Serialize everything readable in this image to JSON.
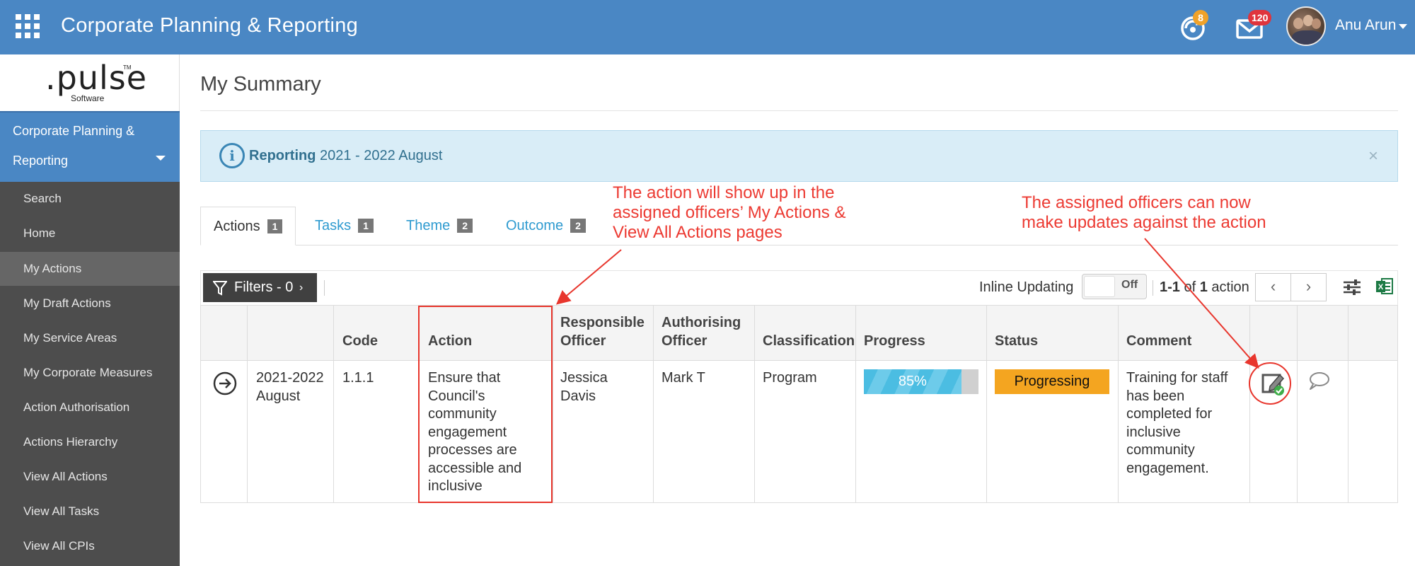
{
  "header": {
    "app_title": "Corporate Planning & Reporting",
    "notifications_count": "8",
    "messages_count": "120",
    "user_name": "Anu Arun"
  },
  "logo": {
    "name": ".pulse",
    "sub": "Software",
    "tm": "TM"
  },
  "sidebar": {
    "module_line1": "Corporate Planning &",
    "module_line2": "Reporting",
    "items": [
      {
        "label": "Search"
      },
      {
        "label": "Home"
      },
      {
        "label": "My Actions"
      },
      {
        "label": "My Draft Actions"
      },
      {
        "label": "My Service Areas"
      },
      {
        "label": "My Corporate Measures"
      },
      {
        "label": "Action Authorisation"
      },
      {
        "label": "Actions Hierarchy"
      },
      {
        "label": "View All Actions"
      },
      {
        "label": "View All Tasks"
      },
      {
        "label": "View All CPIs"
      }
    ]
  },
  "main": {
    "page_title": "My Summary",
    "banner": {
      "bold": "Reporting",
      "text": " 2021 - 2022 August",
      "close": "×"
    },
    "tabs": [
      {
        "label": "Actions",
        "count": "1"
      },
      {
        "label": "Tasks",
        "count": "1"
      },
      {
        "label": "Theme",
        "count": "2"
      },
      {
        "label": "Outcome",
        "count": "2"
      }
    ],
    "toolbar": {
      "filters_label": "Filters - 0",
      "filters_chevron": "›",
      "inline_updating_label": "Inline Updating",
      "toggle_state": "Off",
      "pager_range": "1-1",
      "pager_of": " of ",
      "pager_total": "1",
      "pager_unit": " action",
      "prev": "‹",
      "next": "›"
    },
    "table": {
      "headers": {
        "code": "Code",
        "action": "Action",
        "responsible_1": "Responsible",
        "responsible_2": "Officer",
        "authorising_1": "Authorising",
        "authorising_2": "Officer",
        "classification": "Classification",
        "progress": "Progress",
        "status": "Status",
        "comment": "Comment"
      },
      "row": {
        "period_1": "2021-2022",
        "period_2": "August",
        "code": "1.1.1",
        "action_lines": [
          "Ensure that",
          "Council's",
          "community",
          "engagement",
          "processes are",
          "accessible and",
          "inclusive"
        ],
        "responsible_1": "Jessica",
        "responsible_2": "Davis",
        "authorising": "Mark T",
        "classification": "Program",
        "progress": 85,
        "progress_label": "85%",
        "status": "Progressing",
        "comment_lines": [
          "Training for staff",
          "has been",
          "completed for",
          "inclusive",
          "community",
          "engagement."
        ]
      }
    }
  },
  "annotations": {
    "left_lines": [
      "The action will show up in the",
      "assigned officers’ My Actions &",
      "View All Actions pages"
    ],
    "right_lines": [
      "The assigned officers can now",
      "make updates against the action"
    ]
  },
  "colors": {
    "topbar": "#4a87c4",
    "sidebar": "#4d4d4d",
    "status_progressing": "#f4a520",
    "progress_fill": "#4bbde2",
    "annotation": "#ec3a32"
  },
  "icons": [
    "apps-grid-icon",
    "notifications-icon",
    "mail-icon",
    "info-icon",
    "close-icon",
    "filter-icon",
    "chevron-left-icon",
    "chevron-right-icon",
    "settings-sliders-icon",
    "excel-icon",
    "arrow-right-circle-icon",
    "edit-update-icon",
    "comment-icon"
  ]
}
